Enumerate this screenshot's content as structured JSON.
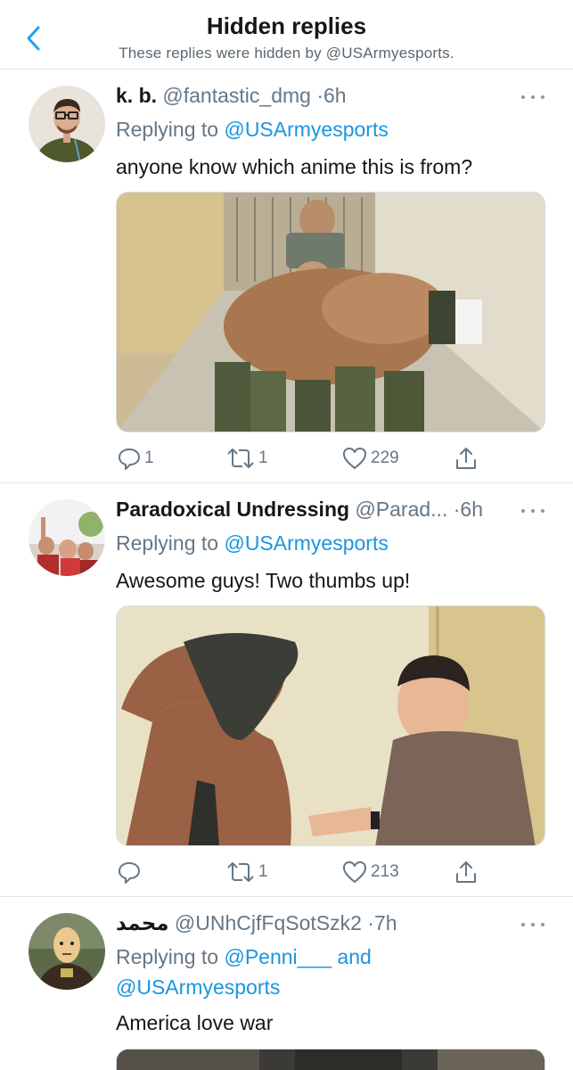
{
  "header": {
    "title": "Hidden replies",
    "subtitle": "These replies were hidden by @USArmyesports."
  },
  "tweets": [
    {
      "name": "k. b.",
      "handle": "@fantastic_dmg",
      "time": "6h",
      "replying_prefix": "Replying to",
      "replying_to": "@USArmyesports",
      "text": "anyone know which anime this is from?",
      "replies": "1",
      "retweets": "1",
      "likes": "229"
    },
    {
      "name": "Paradoxical Undressing",
      "handle": "@Parad...",
      "time": "6h",
      "replying_prefix": "Replying to",
      "replying_to": "@USArmyesports",
      "text": "Awesome guys! Two thumbs up!",
      "replies": "",
      "retweets": "1",
      "likes": "213"
    },
    {
      "name": "محمد",
      "handle": "@UNhCjfFqSotSzk2",
      "time": "7h",
      "replying_prefix": "Replying to",
      "replying_to": "@Penni___",
      "replying_and": "and",
      "replying_to_2": "@USArmyesports",
      "text": "America love war"
    }
  ],
  "colors": {
    "link": "#1b95e0",
    "secondary_text": "#657786",
    "primary_text": "#14171a",
    "accent": "#1da1f2"
  },
  "icons": [
    "chevron-left-icon",
    "more-icon",
    "reply-icon",
    "retweet-icon",
    "like-icon",
    "share-icon"
  ]
}
